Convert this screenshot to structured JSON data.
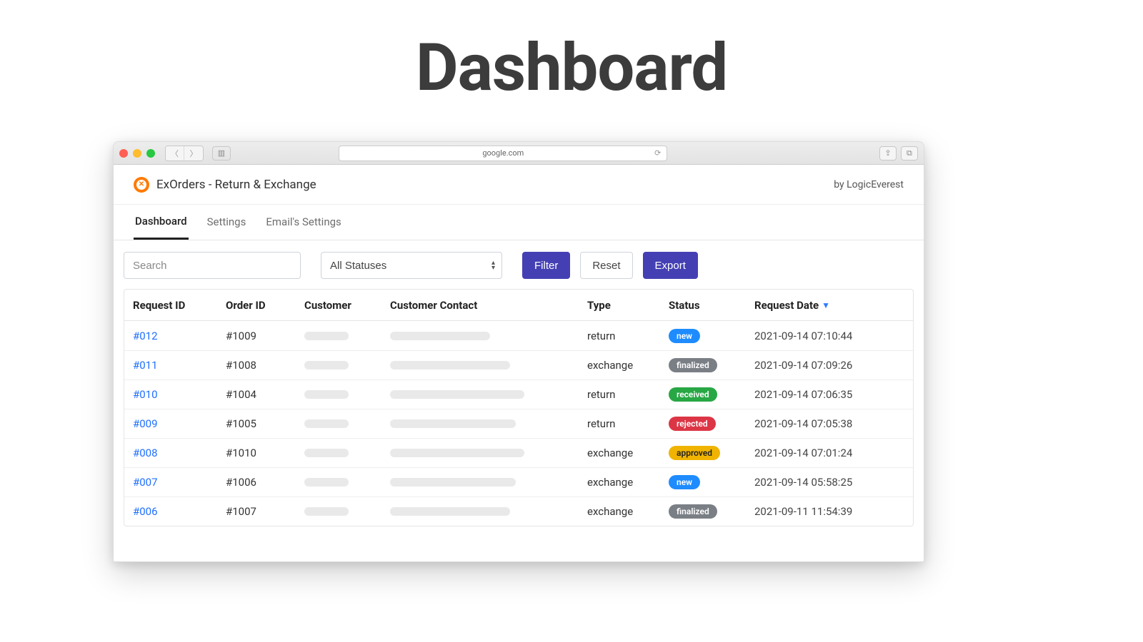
{
  "hero": {
    "title": "Dashboard"
  },
  "browser": {
    "address": "google.com"
  },
  "app": {
    "title": "ExOrders - Return & Exchange",
    "vendor": "by LogicEverest"
  },
  "tabs": [
    {
      "label": "Dashboard",
      "active": true
    },
    {
      "label": "Settings",
      "active": false
    },
    {
      "label": "Email's Settings",
      "active": false
    }
  ],
  "toolbar": {
    "search_placeholder": "Search",
    "status_select_value": "All Statuses",
    "filter_label": "Filter",
    "reset_label": "Reset",
    "export_label": "Export"
  },
  "table": {
    "columns": {
      "request_id": "Request ID",
      "order_id": "Order ID",
      "customer": "Customer",
      "customer_contact": "Customer Contact",
      "type": "Type",
      "status": "Status",
      "request_date": "Request Date"
    },
    "sort": {
      "column": "request_date",
      "direction": "desc"
    },
    "rows": [
      {
        "request_id": "#012",
        "order_id": "#1009",
        "customer": "",
        "customer_contact": "",
        "type": "return",
        "status": "new",
        "request_date": "2021-09-14 07:10:44",
        "contact_len": "med"
      },
      {
        "request_id": "#011",
        "order_id": "#1008",
        "customer": "",
        "customer_contact": "",
        "type": "exchange",
        "status": "finalized",
        "request_date": "2021-09-14 07:09:26",
        "contact_len": "long"
      },
      {
        "request_id": "#010",
        "order_id": "#1004",
        "customer": "",
        "customer_contact": "",
        "type": "return",
        "status": "received",
        "request_date": "2021-09-14 07:06:35",
        "contact_len": "xxlong"
      },
      {
        "request_id": "#009",
        "order_id": "#1005",
        "customer": "",
        "customer_contact": "",
        "type": "return",
        "status": "rejected",
        "request_date": "2021-09-14 07:05:38",
        "contact_len": "xlong"
      },
      {
        "request_id": "#008",
        "order_id": "#1010",
        "customer": "",
        "customer_contact": "",
        "type": "exchange",
        "status": "approved",
        "request_date": "2021-09-14 07:01:24",
        "contact_len": "xxlong"
      },
      {
        "request_id": "#007",
        "order_id": "#1006",
        "customer": "",
        "customer_contact": "",
        "type": "exchange",
        "status": "new",
        "request_date": "2021-09-14 05:58:25",
        "contact_len": "xlong"
      },
      {
        "request_id": "#006",
        "order_id": "#1007",
        "customer": "",
        "customer_contact": "",
        "type": "exchange",
        "status": "finalized",
        "request_date": "2021-09-11 11:54:39",
        "contact_len": "long"
      }
    ]
  }
}
